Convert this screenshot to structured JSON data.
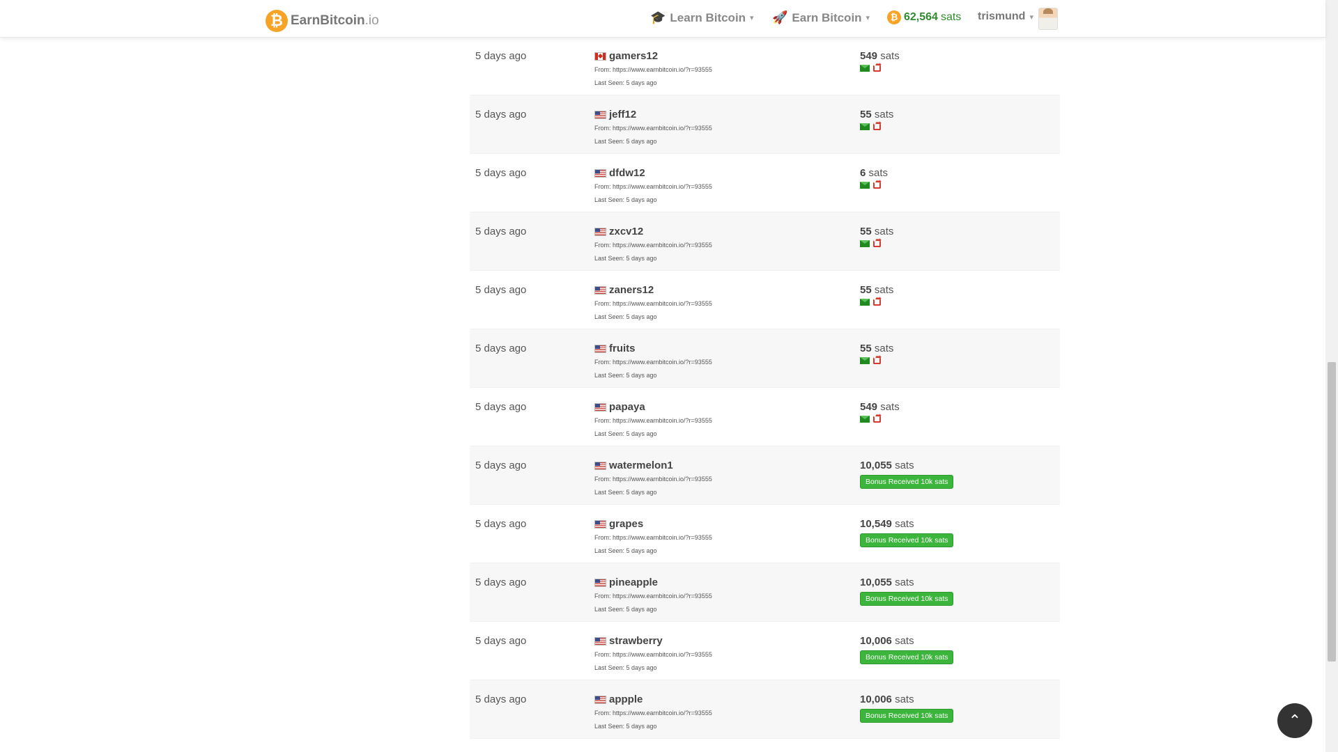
{
  "header": {
    "logo_main": "EarnBitcoin",
    "logo_tld": ".io",
    "nav": [
      {
        "label": "Learn Bitcoin",
        "icon": "graduation-cap-icon"
      },
      {
        "label": "Earn Bitcoin",
        "icon": "rocket-icon"
      }
    ],
    "balance": {
      "value": "62,564",
      "unit": "sats"
    },
    "user": {
      "name": "trismund"
    }
  },
  "referrals": [
    {
      "time": "5 days ago",
      "flag": "ca",
      "username": "gamers12",
      "from": "From: https://www.earnbitcoin.io/?r=93555",
      "last_seen": "Last Seen: 5 days ago",
      "sats_value": "549",
      "sats_unit": "sats",
      "bonus": null
    },
    {
      "time": "5 days ago",
      "flag": "us",
      "username": "jeff12",
      "from": "From: https://www.earnbitcoin.io/?r=93555",
      "last_seen": "Last Seen: 5 days ago",
      "sats_value": "55",
      "sats_unit": "sats",
      "bonus": null
    },
    {
      "time": "5 days ago",
      "flag": "us",
      "username": "dfdw12",
      "from": "From: https://www.earnbitcoin.io/?r=93555",
      "last_seen": "Last Seen: 5 days ago",
      "sats_value": "6",
      "sats_unit": "sats",
      "bonus": null
    },
    {
      "time": "5 days ago",
      "flag": "us",
      "username": "zxcv12",
      "from": "From: https://www.earnbitcoin.io/?r=93555",
      "last_seen": "Last Seen: 5 days ago",
      "sats_value": "55",
      "sats_unit": "sats",
      "bonus": null
    },
    {
      "time": "5 days ago",
      "flag": "us",
      "username": "zaners12",
      "from": "From: https://www.earnbitcoin.io/?r=93555",
      "last_seen": "Last Seen: 5 days ago",
      "sats_value": "55",
      "sats_unit": "sats",
      "bonus": null
    },
    {
      "time": "5 days ago",
      "flag": "us",
      "username": "fruits",
      "from": "From: https://www.earnbitcoin.io/?r=93555",
      "last_seen": "Last Seen: 5 days ago",
      "sats_value": "55",
      "sats_unit": "sats",
      "bonus": null
    },
    {
      "time": "5 days ago",
      "flag": "us",
      "username": "papaya",
      "from": "From: https://www.earnbitcoin.io/?r=93555",
      "last_seen": "Last Seen: 5 days ago",
      "sats_value": "549",
      "sats_unit": "sats",
      "bonus": null
    },
    {
      "time": "5 days ago",
      "flag": "us",
      "username": "watermelon1",
      "from": "From: https://www.earnbitcoin.io/?r=93555",
      "last_seen": "Last Seen: 5 days ago",
      "sats_value": "10,055",
      "sats_unit": "sats",
      "bonus": "Bonus Received 10k sats"
    },
    {
      "time": "5 days ago",
      "flag": "us",
      "username": "grapes",
      "from": "From: https://www.earnbitcoin.io/?r=93555",
      "last_seen": "Last Seen: 5 days ago",
      "sats_value": "10,549",
      "sats_unit": "sats",
      "bonus": "Bonus Received 10k sats"
    },
    {
      "time": "5 days ago",
      "flag": "us",
      "username": "pineapple",
      "from": "From: https://www.earnbitcoin.io/?r=93555",
      "last_seen": "Last Seen: 5 days ago",
      "sats_value": "10,055",
      "sats_unit": "sats",
      "bonus": "Bonus Received 10k sats"
    },
    {
      "time": "5 days ago",
      "flag": "us",
      "username": "strawberry",
      "from": "From: https://www.earnbitcoin.io/?r=93555",
      "last_seen": "Last Seen: 5 days ago",
      "sats_value": "10,006",
      "sats_unit": "sats",
      "bonus": "Bonus Received 10k sats"
    },
    {
      "time": "5 days ago",
      "flag": "us",
      "username": "appple",
      "from": "From: https://www.earnbitcoin.io/?r=93555",
      "last_seen": "Last Seen: 5 days ago",
      "sats_value": "10,006",
      "sats_unit": "sats",
      "bonus": "Bonus Received 10k sats"
    }
  ],
  "colors": {
    "brand": "#f7a326",
    "success": "#3cb53c",
    "danger": "#d63b2f"
  }
}
